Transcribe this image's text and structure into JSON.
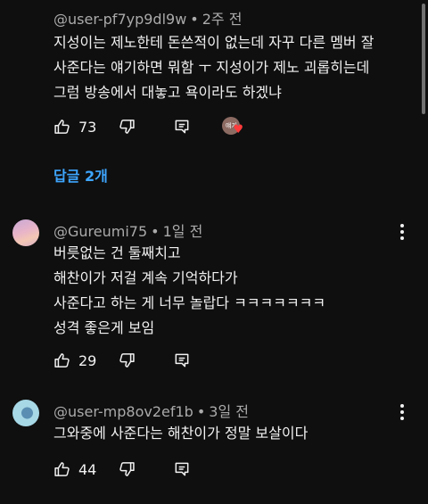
{
  "comments": [
    {
      "author": "@user-pf7yp9dl9w",
      "time": "2주 전",
      "lines": [
        "지성이는 제노한테 돈쓴적이 없는데 자꾸 다른 멤버 잘",
        "사준다는 얘기하면 뭐함 ㅜ 지성이가 제노 괴롭히는데",
        "그럼 방송에서 대놓고 욕이라도 하겠냐"
      ],
      "likes": "73",
      "creator_heart_avatar_text": "얘기",
      "replies_label": "답글 2개"
    },
    {
      "author": "@Gureumi75",
      "time": "1일 전",
      "lines": [
        "버릇없는 건 둘째치고",
        "해찬이가 저걸 계속 기억하다가",
        "사준다고 하는 게 너무 놀랍다 ㅋㅋㅋㅋㅋㅋㅋ",
        "성격 좋은게 보임"
      ],
      "likes": "29"
    },
    {
      "author": "@user-mp8ov2ef1b",
      "time": "3일 전",
      "lines": [
        "그와중에 사준다는 해찬이가 정말 보살이다"
      ],
      "likes": "44"
    }
  ],
  "separator": "•",
  "colors": {
    "background": "#0f0f0f",
    "text": "#f1f1f1",
    "meta": "#aaaaaa",
    "link": "#3ea6ff",
    "heart": "#ff3b3b"
  },
  "icons": {
    "like": "thumbs-up-icon",
    "dislike": "thumbs-down-icon",
    "reply": "comment-reply-icon",
    "more": "more-vertical-icon",
    "heart": "creator-heart-icon"
  }
}
